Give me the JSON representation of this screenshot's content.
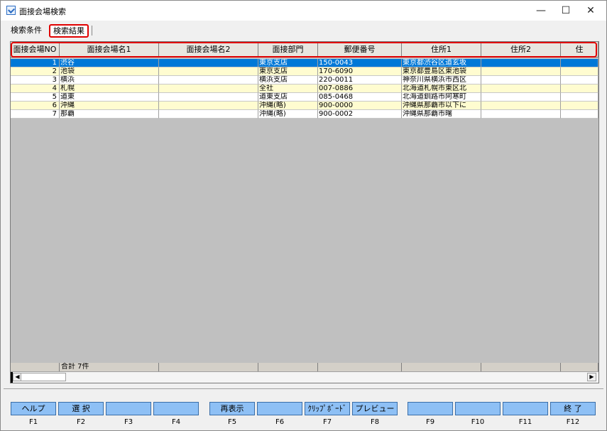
{
  "window": {
    "title": "面接会場検索",
    "min_glyph": "—",
    "max_glyph": "☐",
    "close_glyph": "✕"
  },
  "tabs": [
    {
      "label": "検索条件",
      "active": false
    },
    {
      "label": "検索結果",
      "active": true
    }
  ],
  "grid": {
    "columns": [
      "面接会場NO",
      "面接会場名1",
      "面接会場名2",
      "面接部門",
      "郵便番号",
      "住所1",
      "住所2",
      "住"
    ],
    "rows": [
      {
        "no": "1",
        "name1": "渋谷",
        "name2": "",
        "dept": "東京支店",
        "zip": "150-0043",
        "addr1": "東京都渋谷区道玄坂",
        "addr2": ""
      },
      {
        "no": "2",
        "name1": "池袋",
        "name2": "",
        "dept": "東京支店",
        "zip": "170-6090",
        "addr1": "東京都豊島区東池袋",
        "addr2": ""
      },
      {
        "no": "3",
        "name1": "横浜",
        "name2": "",
        "dept": "横浜支店",
        "zip": "220-0011",
        "addr1": "神奈川県横浜市西区",
        "addr2": ""
      },
      {
        "no": "4",
        "name1": "札幌",
        "name2": "",
        "dept": "全社",
        "zip": "007-0886",
        "addr1": "北海道札幌市東区北",
        "addr2": ""
      },
      {
        "no": "5",
        "name1": "道東",
        "name2": "",
        "dept": "道東支店",
        "zip": "085-0468",
        "addr1": "北海道釧路市阿寒町",
        "addr2": ""
      },
      {
        "no": "6",
        "name1": "沖縄",
        "name2": "",
        "dept": "沖縄(略)",
        "zip": "900-0000",
        "addr1": "沖縄県那覇市以下に",
        "addr2": ""
      },
      {
        "no": "7",
        "name1": "那覇",
        "name2": "",
        "dept": "沖縄(略)",
        "zip": "900-0002",
        "addr1": "沖縄県那覇市曙",
        "addr2": ""
      }
    ],
    "total_label": "合計 7件",
    "selected_row_color": "#0078d7",
    "odd_row_color": "#ffffff",
    "even_row_color": "#fffcd0"
  },
  "function_keys": [
    {
      "label": "ヘルプ",
      "key": "F1"
    },
    {
      "label": "選 択",
      "key": "F2"
    },
    {
      "label": "",
      "key": "F3"
    },
    {
      "label": "",
      "key": "F4"
    },
    {
      "label": "再表示",
      "key": "F5"
    },
    {
      "label": "",
      "key": "F6"
    },
    {
      "label": "ｸﾘｯﾌﾟﾎﾞｰﾄﾞ",
      "key": "F7"
    },
    {
      "label": "プレビュー",
      "key": "F8"
    },
    {
      "label": "",
      "key": "F9"
    },
    {
      "label": "",
      "key": "F10"
    },
    {
      "label": "",
      "key": "F11"
    },
    {
      "label": "終 了",
      "key": "F12"
    }
  ],
  "colors": {
    "fkey_bg": "#8ec0f5",
    "highlight_border": "#e00000"
  }
}
